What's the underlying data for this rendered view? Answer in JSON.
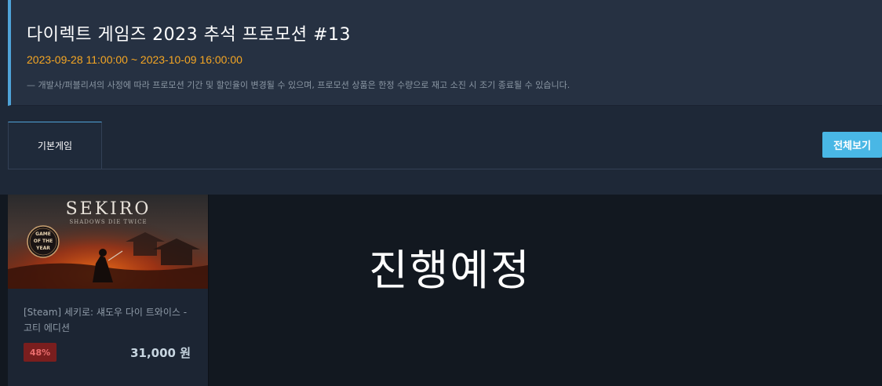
{
  "promo": {
    "title": "다이렉트 게임즈 2023 추석 프로모션 #13",
    "dates": "2023-09-28 11:00:00 ~ 2023-10-09 16:00:00",
    "notice": "— 개발사/퍼블리셔의 사정에 따라 프로모션 기간 및 할인율이 변경될 수 있으며, 프로모션 상품은 한정 수량으로 재고 소진 시 조기 종료될 수 있습니다."
  },
  "tabs": [
    {
      "label": "기본게임",
      "active": true
    }
  ],
  "view_all_label": "전체보기",
  "status_overlay": "진행예정",
  "products": [
    {
      "name": "[Steam] 세키로: 섀도우 다이 트와이스 - 고티 에디션",
      "discount": "48%",
      "price": "31,000 원",
      "thumbnail": {
        "logo_title": "SEKIRO",
        "logo_subtitle": "SHADOWS DIE TWICE",
        "badge_lines": [
          "GAME",
          "OF THE",
          "YEAR"
        ]
      }
    }
  ],
  "colors": {
    "accent": "#49b7e5",
    "date": "#f5a623",
    "discount_bg": "#7a1e1e",
    "discount_text": "#e96d6d",
    "background": "#1e2837"
  }
}
